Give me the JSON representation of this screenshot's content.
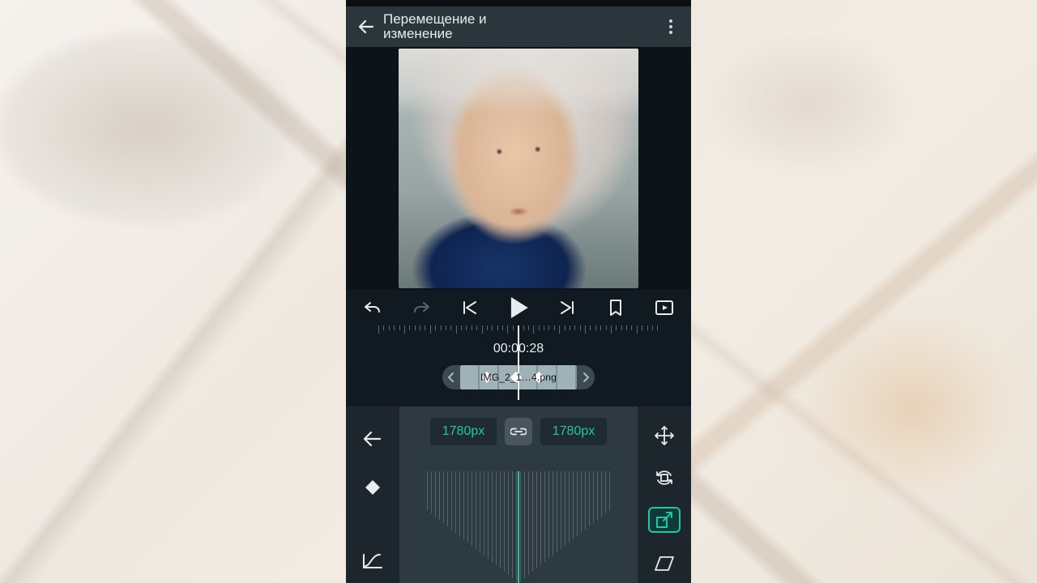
{
  "header": {
    "title_line1": "Перемещение и",
    "title_line2": "изменение"
  },
  "timecode": "00:00:28",
  "clip": {
    "filename": "IMG_2_1…4.png"
  },
  "size_panel": {
    "width_label": "1780px",
    "height_label": "1780px"
  },
  "colors": {
    "accent": "#1ec9a0"
  }
}
